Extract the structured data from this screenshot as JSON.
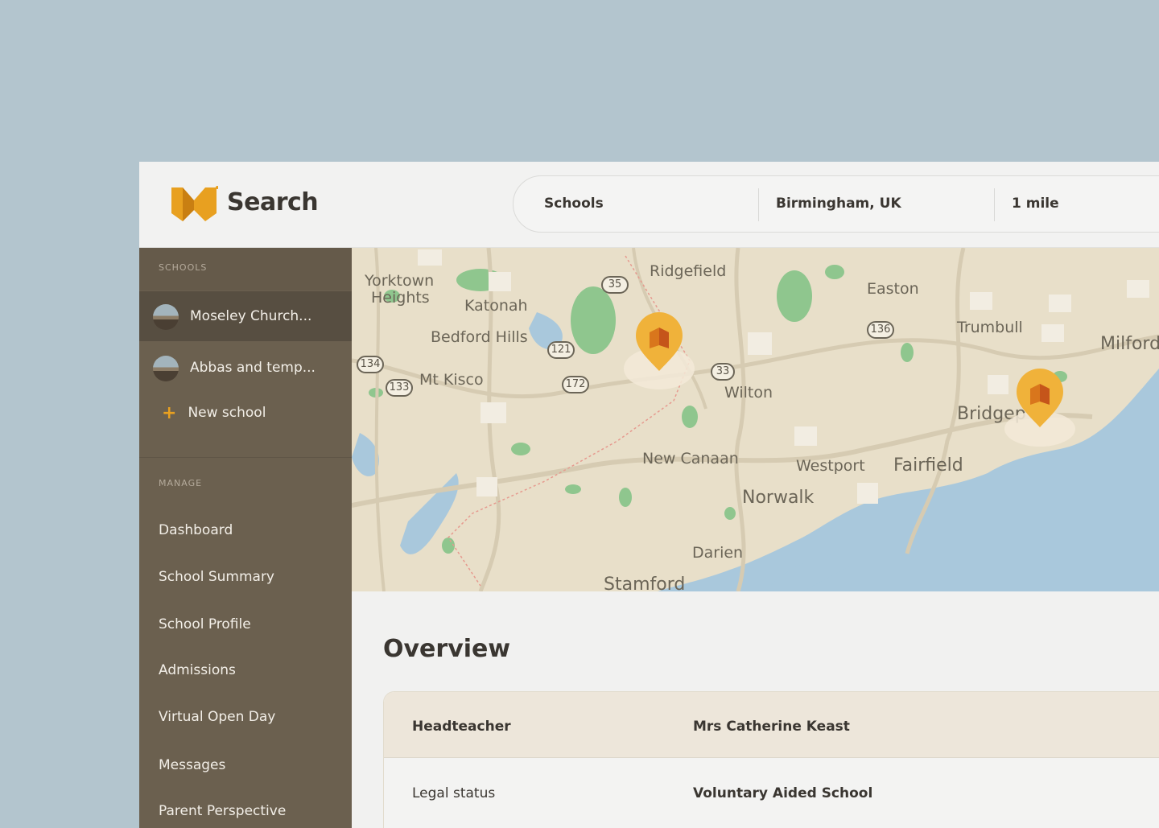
{
  "brand": {
    "name": "Search",
    "logo_icon": "m-shield-logo-icon",
    "accent": "#e8a020"
  },
  "search": {
    "type": "Schools",
    "location": "Birmingham, UK",
    "radius": "1 mile"
  },
  "sidebar": {
    "schools_heading": "SCHOOLS",
    "schools": [
      {
        "name": "Moseley Church...",
        "active": true
      },
      {
        "name": "Abbas and temp...",
        "active": false
      }
    ],
    "new_school_label": "New school",
    "manage_heading": "MANAGE",
    "nav": [
      "Dashboard",
      "School Summary",
      "School Profile",
      "Admissions",
      "Virtual Open Day",
      "Messages",
      "Parent Perspective"
    ]
  },
  "map": {
    "places": [
      "Yorktown",
      "Heights",
      "Katonah",
      "Bedford Hills",
      "Mt Kisco",
      "Ridgefield",
      "Wilton",
      "Easton",
      "Trumbull",
      "Milford",
      "Bridgeport",
      "Fairfield",
      "Westport",
      "Norwalk",
      "New Canaan",
      "Darien",
      "Stamford"
    ],
    "routes": [
      "35",
      "121",
      "172",
      "134",
      "133",
      "33",
      "136"
    ]
  },
  "overview": {
    "title": "Overview",
    "rows": [
      {
        "label": "Headteacher",
        "value": "Mrs Catherine Keast"
      },
      {
        "label": "Legal status",
        "value": "Voluntary Aided School"
      }
    ]
  }
}
